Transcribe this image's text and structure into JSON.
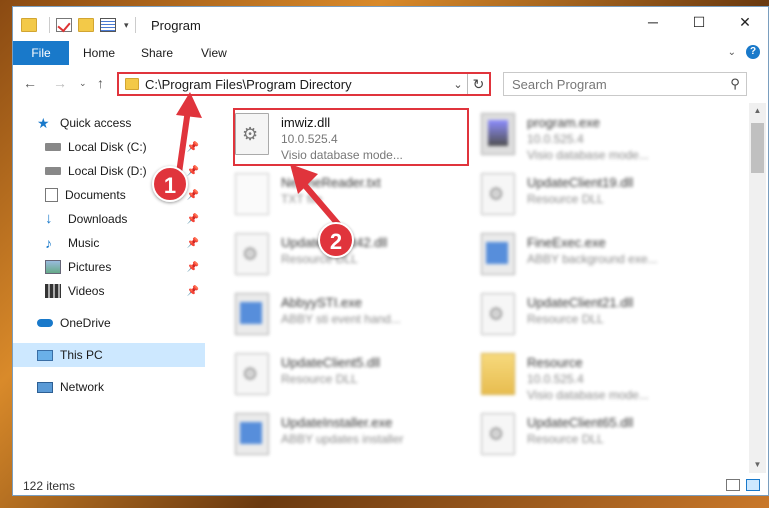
{
  "window": {
    "title": "Program"
  },
  "ribbon": {
    "tabs": [
      "File",
      "Home",
      "Share",
      "View"
    ]
  },
  "address": {
    "path": "C:\\Program Files\\Program Directory"
  },
  "search": {
    "placeholder": "Search Program"
  },
  "nav": {
    "items": [
      {
        "label": "Quick access",
        "icon": "star-icon"
      },
      {
        "label": "Local Disk (C:)",
        "icon": "drive-icon",
        "pinned": true
      },
      {
        "label": "Local Disk (D:)",
        "icon": "drive-icon",
        "pinned": true
      },
      {
        "label": "Documents",
        "icon": "documents-icon",
        "pinned": true
      },
      {
        "label": "Downloads",
        "icon": "download-icon",
        "pinned": true
      },
      {
        "label": "Music",
        "icon": "music-icon",
        "pinned": true
      },
      {
        "label": "Pictures",
        "icon": "pictures-icon",
        "pinned": true
      },
      {
        "label": "Videos",
        "icon": "videos-icon",
        "pinned": true
      },
      {
        "label": "OneDrive",
        "icon": "cloud-icon"
      },
      {
        "label": "This PC",
        "icon": "computer-icon",
        "selected": true
      },
      {
        "label": "Network",
        "icon": "network-icon"
      }
    ]
  },
  "files": [
    {
      "name": "imwiz.dll",
      "line1": "10.0.525.4",
      "line2": "Visio database mode...",
      "icon": "dll-icon",
      "highlighted": true
    },
    {
      "name": "program.exe",
      "line1": "10.0.525.4",
      "line2": "Visio database mode...",
      "icon": "exe-icon"
    },
    {
      "name": "NetlineReader.txt",
      "line1": "TXT file",
      "line2": "",
      "icon": "txt-icon"
    },
    {
      "name": "UpdateClient19.dll",
      "line1": "Resource DLL",
      "line2": "",
      "icon": "dll-icon"
    },
    {
      "name": "UpdateClient42.dll",
      "line1": "Resource DLL",
      "line2": "",
      "icon": "dll-icon"
    },
    {
      "name": "FineExec.exe",
      "line1": "ABBY background exe...",
      "line2": "",
      "icon": "app-icon"
    },
    {
      "name": "AbbyySTI.exe",
      "line1": "ABBY sti event hand...",
      "line2": "",
      "icon": "app-icon"
    },
    {
      "name": "UpdateClient21.dll",
      "line1": "Resource DLL",
      "line2": "",
      "icon": "dll-icon"
    },
    {
      "name": "UpdateClient5.dll",
      "line1": "Resource DLL",
      "line2": "",
      "icon": "dll-icon"
    },
    {
      "name": "Resource",
      "line1": "10.0.525.4",
      "line2": "Visio database mode...",
      "icon": "folder-icon"
    },
    {
      "name": "UpdateInstaller.exe",
      "line1": "ABBY updates installer",
      "line2": "",
      "icon": "app-icon"
    },
    {
      "name": "UpdateClient65.dll",
      "line1": "Resource DLL",
      "line2": "",
      "icon": "dll-icon"
    }
  ],
  "status": {
    "items_count": "122 items"
  },
  "annotations": {
    "badge1": "1",
    "badge2": "2"
  },
  "colors": {
    "accent": "#1979ca",
    "annotation": "#e0343c",
    "selection": "#cde8ff"
  }
}
